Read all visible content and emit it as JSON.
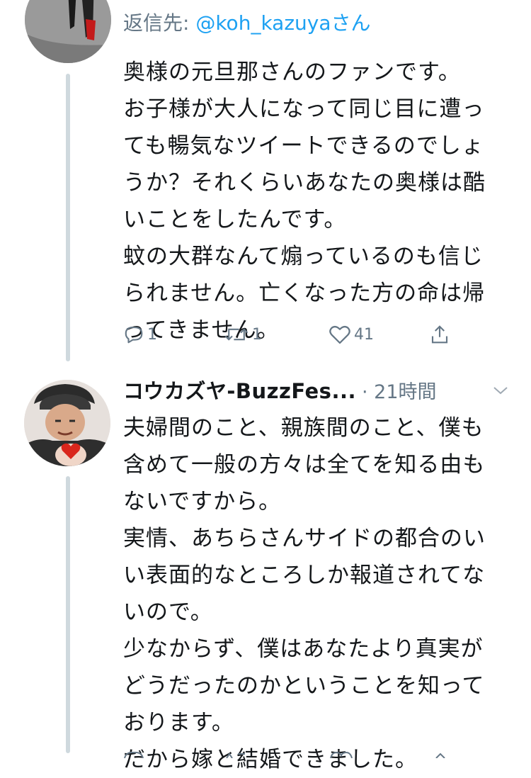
{
  "tweet1": {
    "reply_prefix": "返信先: ",
    "reply_mention": "@koh_kazuyaさん",
    "text_lines": [
      "奥様の元旦那さんのファンです。",
      "お子様が大人になって同じ目に遭っ",
      "ても暢気なツイートできるのでしょ",
      "うか？それくらいあなたの奥様は酷",
      "いことをしたんです。",
      "蚊の大群なんて煽っているのも信じ",
      "られません。亡くなった方の命は帰",
      "ってきません。"
    ],
    "actions": {
      "reply_icon": "reply-icon",
      "reply_count": "1",
      "retweet_icon": "retweet-icon",
      "retweet_count": "1",
      "like_icon": "heart-icon",
      "like_count": "41",
      "share_icon": "share-icon"
    }
  },
  "tweet2": {
    "display_name": "コウカズヤ-BuzzFes...",
    "time": "· 21時間",
    "menu_icon": "chevron-down-icon",
    "text_lines": [
      "夫婦間のこと、親族間のこと、僕も",
      "含めて一般の方々は全てを知る由も",
      "ないですから。",
      "実情、あちらさんサイドの都合のい",
      "い表面的なところしか報道されてな",
      "いので。",
      "少なからず、僕はあなたより真実が",
      "どうだったのかということを知って",
      "おります。",
      "だから嫁と結婚できました。"
    ]
  },
  "colors": {
    "text": "#14171a",
    "secondary": "#657786",
    "link": "#1da1f2",
    "thread_line": "#cfd9de"
  }
}
